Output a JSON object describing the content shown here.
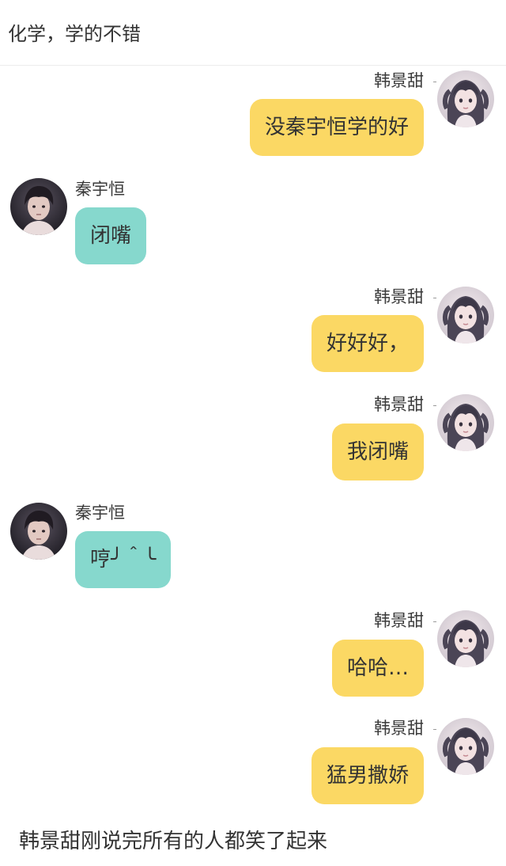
{
  "header": {
    "caption": "化学，学的不错"
  },
  "users": {
    "her": {
      "name": "韩景甜",
      "avatar_icon": "girl-avatar-icon"
    },
    "him": {
      "name": "秦宇恒",
      "avatar_icon": "boy-avatar-icon"
    }
  },
  "colors": {
    "right_bubble": "#fbd864",
    "left_bubble": "#86d8cd",
    "text": "#333333"
  },
  "messages": [
    {
      "side": "right",
      "sender": "韩景甜",
      "text": "没秦宇恒学的好"
    },
    {
      "side": "left",
      "sender": "秦宇恒",
      "text": "闭嘴"
    },
    {
      "side": "right",
      "sender": "韩景甜",
      "text": "好好好，"
    },
    {
      "side": "right",
      "sender": "韩景甜",
      "text": "我闭嘴"
    },
    {
      "side": "left",
      "sender": "秦宇恒",
      "text": "哼╯＾╰"
    },
    {
      "side": "right",
      "sender": "韩景甜",
      "text": "哈哈…"
    },
    {
      "side": "right",
      "sender": "韩景甜",
      "text": "猛男撒娇"
    }
  ],
  "footer": {
    "caption": "韩景甜刚说完所有的人都笑了起来"
  }
}
